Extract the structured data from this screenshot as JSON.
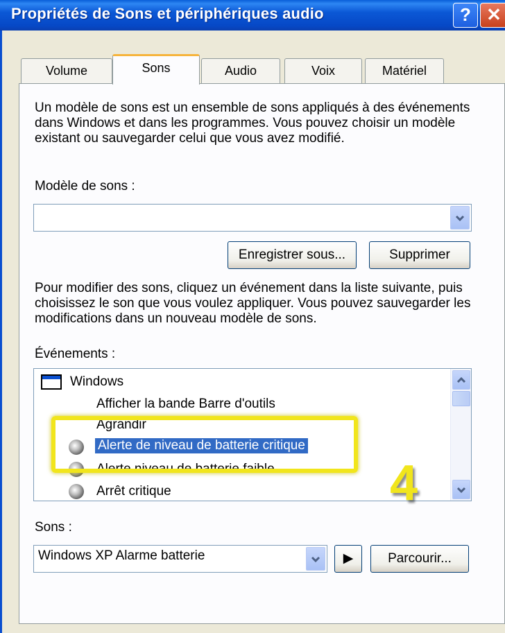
{
  "window": {
    "title": "Propriétés de Sons et périphériques audio",
    "help_label": "?",
    "close_label": "✕"
  },
  "tabs": [
    {
      "label": "Volume",
      "active": false
    },
    {
      "label": "Sons",
      "active": true
    },
    {
      "label": "Audio",
      "active": false
    },
    {
      "label": "Voix",
      "active": false
    },
    {
      "label": "Matériel",
      "active": false
    }
  ],
  "intro_text": "Un modèle de sons est un ensemble de sons appliqués à des événements dans Windows et dans les programmes. Vous pouvez choisir un modèle existant ou sauvegarder celui que vous avez modifié.",
  "scheme": {
    "label": "Modèle de sons :",
    "value": "",
    "save_as_label": "Enregistrer sous...",
    "delete_label": "Supprimer"
  },
  "events_help_text": "Pour modifier des sons, cliquez un événement dans la liste suivante, puis choisissez le son que vous voulez appliquer. Vous pouvez sauvegarder les modifications dans un nouveau modèle de sons.",
  "events": {
    "label": "Événements :",
    "group": "Windows",
    "items": [
      {
        "label": "Afficher la bande Barre d'outils",
        "icon": "none"
      },
      {
        "label": "Agrandir",
        "icon": "none"
      },
      {
        "label": "Alerte de niveau de batterie critique",
        "icon": "speaker-icon",
        "selected": true
      },
      {
        "label": "Alerte niveau de batterie faible",
        "icon": "speaker-icon"
      },
      {
        "label": "Arrêt critique",
        "icon": "speaker-icon"
      }
    ]
  },
  "sounds": {
    "label": "Sons :",
    "value": "Windows XP Alarme batterie",
    "play_label": "▶",
    "browse_label": "Parcourir..."
  },
  "annotation": {
    "step_number": "4",
    "color": "#f1e51c"
  },
  "colors": {
    "selection": "#316ac5",
    "titlebar": "#0b58d6",
    "tab_accent": "#f6b43c"
  }
}
